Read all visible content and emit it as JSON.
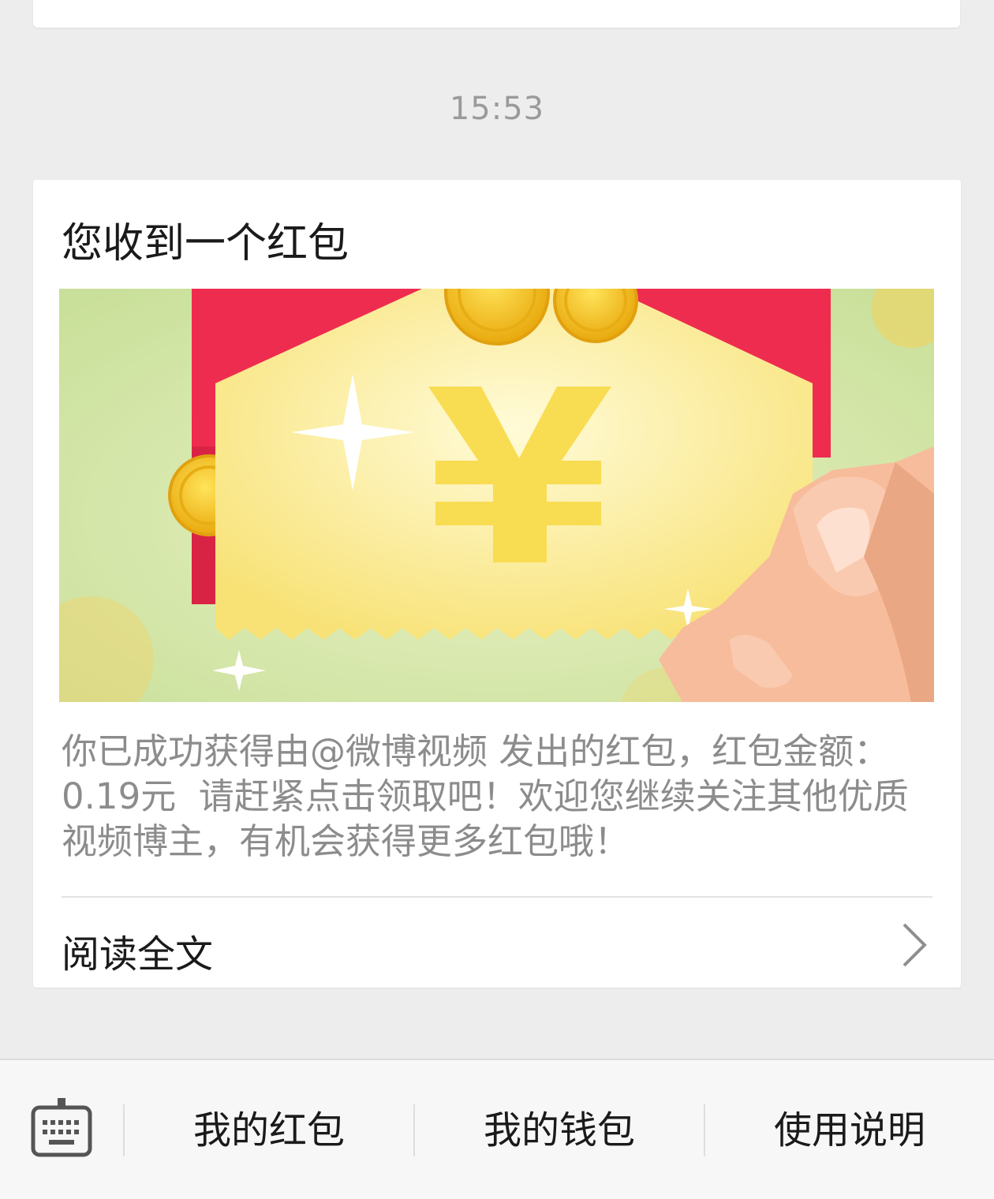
{
  "timestamp": "15:53",
  "message": {
    "title": "您收到一个红包",
    "description": "你已成功获得由@微博视频 发出的红包，红包金额：0.19元  请赶紧点击领取吧！欢迎您继续关注其他优质视频博主，有机会获得更多红包哦！",
    "image_icon": "red-envelope-illustration",
    "read_more_label": "阅读全文",
    "read_more_icon": "chevron-right-icon"
  },
  "bottom_menu": {
    "keyboard_icon": "keyboard-icon",
    "items": [
      {
        "label": "我的红包"
      },
      {
        "label": "我的钱包"
      },
      {
        "label": "使用说明"
      }
    ]
  },
  "colors": {
    "background": "#ededed",
    "card": "#ffffff",
    "envelope_red": "#ee2c4f",
    "ticket_yellow": "#fbeb8f",
    "coin_gold": "#f5c518",
    "hand_skin": "#f7bc9b",
    "bg_green": "#d6e8a8"
  }
}
